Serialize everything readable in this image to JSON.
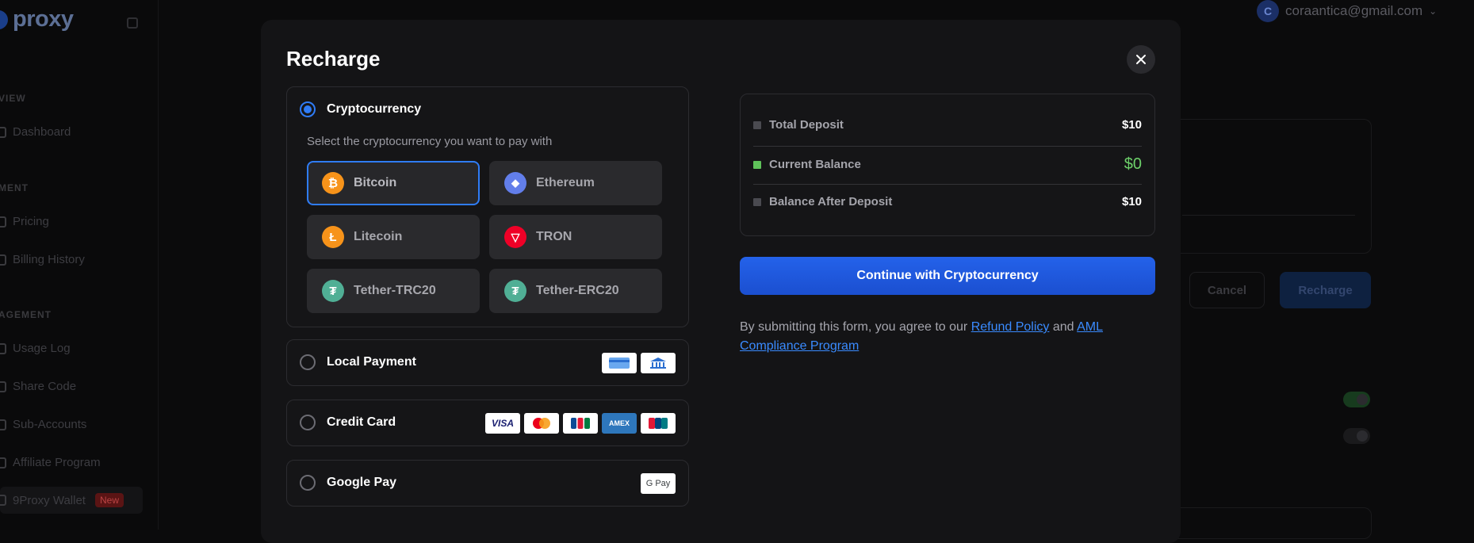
{
  "background": {
    "logo_text": "proxy",
    "sections": [
      "VIEW",
      "MENT",
      "AGEMENT"
    ],
    "items": [
      "Dashboard",
      "Pricing",
      "Billing History",
      "Usage Log",
      "Share Code",
      "Sub-Accounts",
      "Affiliate Program",
      "9Proxy Wallet"
    ],
    "wallet_badge": "New",
    "user_initial": "C",
    "user_email": "coraantica@gmail.com",
    "cancel_label": "Cancel",
    "recharge_label": "Recharge"
  },
  "modal": {
    "title": "Recharge",
    "methods": {
      "crypto": {
        "label": "Cryptocurrency",
        "selected": true,
        "subtitle": "Select the cryptocurrency you want to pay with",
        "coins": [
          {
            "name": "Bitcoin",
            "icon": "bitcoin-icon",
            "color": "#f7931a",
            "glyph": "₿",
            "selected": true
          },
          {
            "name": "Ethereum",
            "icon": "ethereum-icon",
            "color": "#627eea",
            "glyph": "◆",
            "selected": false
          },
          {
            "name": "Litecoin",
            "icon": "litecoin-icon",
            "color": "#f7931a",
            "glyph": "Ł",
            "selected": false
          },
          {
            "name": "TRON",
            "icon": "tron-icon",
            "color": "#ef0027",
            "glyph": "▽",
            "selected": false
          },
          {
            "name": "Tether-TRC20",
            "icon": "tether-icon",
            "color": "#50af95",
            "glyph": "₮",
            "selected": false
          },
          {
            "name": "Tether-ERC20",
            "icon": "tether-icon",
            "color": "#50af95",
            "glyph": "₮",
            "selected": false
          }
        ]
      },
      "local": {
        "label": "Local Payment",
        "badges": [
          "card-icon",
          "bank-icon"
        ]
      },
      "card": {
        "label": "Credit Card",
        "badges": [
          "VISA",
          "mastercard",
          "JCB",
          "AMEX",
          "UnionPay"
        ]
      },
      "gpay": {
        "label": "Google Pay",
        "badge": "G Pay"
      }
    },
    "summary": {
      "total_deposit_label": "Total Deposit",
      "total_deposit_value": "$10",
      "current_balance_label": "Current Balance",
      "current_balance_value": "$0",
      "after_deposit_label": "Balance After Deposit",
      "after_deposit_value": "$10"
    },
    "continue_label": "Continue with Cryptocurrency",
    "terms": {
      "prefix": "By submitting this form, you agree to our ",
      "refund": "Refund Policy",
      "and": " and ",
      "aml": "AML Compliance Program"
    },
    "colors": {
      "accent": "#2f7cf6",
      "button": "#1f5ae0",
      "positive": "#6dd06a"
    }
  }
}
